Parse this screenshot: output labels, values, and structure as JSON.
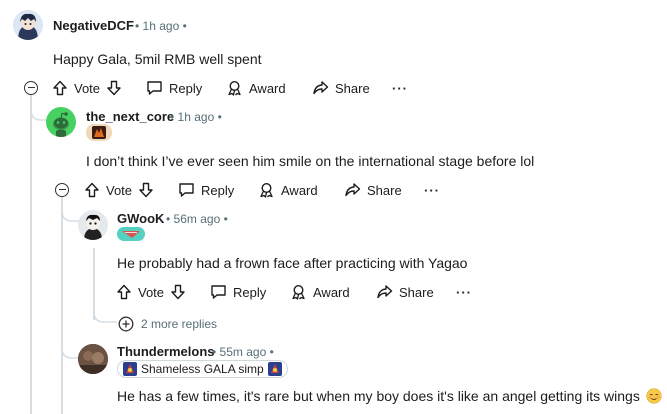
{
  "comments": [
    {
      "user": "NegativeDCF",
      "time": "1h ago",
      "body": "Happy Gala, 5mil RMB well spent",
      "actions": {
        "vote": "Vote",
        "reply": "Reply",
        "award": "Award",
        "share": "Share",
        "more": "···"
      }
    },
    {
      "user": "the_next_core",
      "time": "1h ago",
      "body": "I don’t think I’ve ever seen him smile on the international stage before lol",
      "actions": {
        "vote": "Vote",
        "reply": "Reply",
        "award": "Award",
        "share": "Share",
        "more": "···"
      }
    },
    {
      "user": "GWooK",
      "time": "56m ago",
      "body": "He probably had a frown face after practicing with Yagao",
      "actions": {
        "vote": "Vote",
        "reply": "Reply",
        "award": "Award",
        "share": "Share",
        "more": "···"
      },
      "more_replies": "2 more replies"
    },
    {
      "user": "Thundermelons",
      "time": "55m ago",
      "flair": "Shameless GALA simp",
      "body": "He has a few times, it's rare but when my boy does it's like an angel getting its wings"
    }
  ],
  "separator": "•",
  "colors": {
    "rail": "#d6dde2",
    "meta": "#576f76",
    "accent_green": "#46d160",
    "flair_teal": "#56d1c1"
  }
}
